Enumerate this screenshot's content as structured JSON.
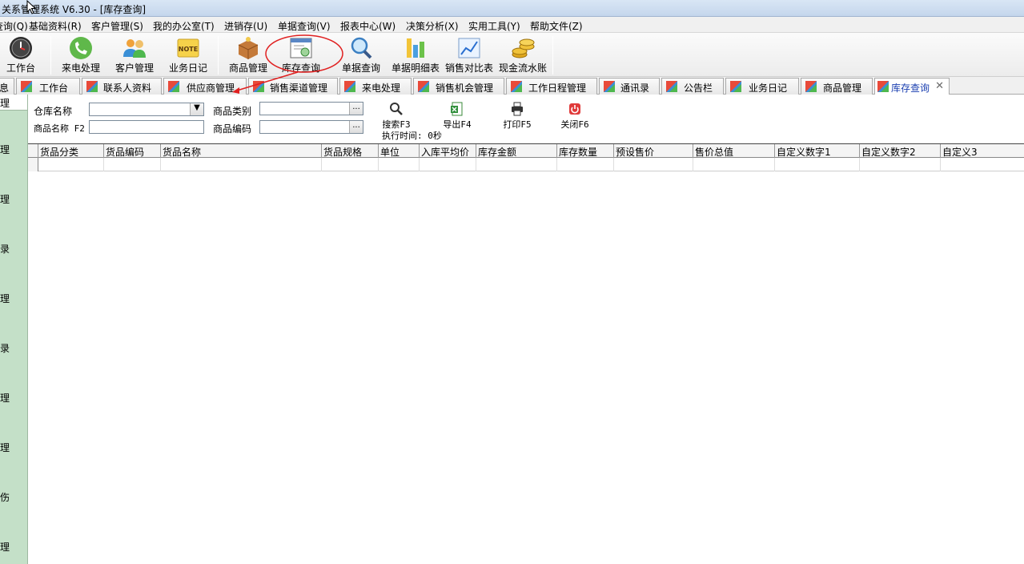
{
  "window": {
    "title": "关系管理系统 V6.30 - [库存查询]"
  },
  "menu": [
    {
      "label": "查询(Q)"
    },
    {
      "label": "基础资料(R)"
    },
    {
      "label": "客户管理(S)"
    },
    {
      "label": "我的办公室(T)"
    },
    {
      "label": "进销存(U)"
    },
    {
      "label": "单据查询(V)"
    },
    {
      "label": "报表中心(W)"
    },
    {
      "label": "决策分析(X)"
    },
    {
      "label": "实用工具(Y)"
    },
    {
      "label": "帮助文件(Z)"
    }
  ],
  "toolbar": [
    {
      "label": "工作台",
      "icon": "clock-icon"
    },
    {
      "label": "来电处理",
      "icon": "phone-icon"
    },
    {
      "label": "客户管理",
      "icon": "users-icon"
    },
    {
      "label": "业务日记",
      "icon": "note-icon",
      "icon_text": "NOTE"
    },
    {
      "label": "商品管理",
      "icon": "box-icon"
    },
    {
      "label": "库存查询",
      "icon": "window-search-icon"
    },
    {
      "label": "单据查询",
      "icon": "magnifier-icon"
    },
    {
      "label": "单据明细表",
      "icon": "bar-chart-icon"
    },
    {
      "label": "销售对比表",
      "icon": "line-chart-icon"
    },
    {
      "label": "现金流水账",
      "icon": "coins-icon"
    }
  ],
  "tabs": [
    {
      "label": "息"
    },
    {
      "label": "工作台"
    },
    {
      "label": "联系人资料"
    },
    {
      "label": "供应商管理"
    },
    {
      "label": "销售渠道管理"
    },
    {
      "label": "来电处理"
    },
    {
      "label": "销售机会管理"
    },
    {
      "label": "工作日程管理"
    },
    {
      "label": "通讯录"
    },
    {
      "label": "公告栏"
    },
    {
      "label": "业务日记"
    },
    {
      "label": "商品管理"
    },
    {
      "label": "库存查询",
      "active": true,
      "close": "✕"
    }
  ],
  "sidebar": [
    "理",
    "理",
    "理",
    "录",
    "理",
    "录",
    "理",
    "理",
    "伤",
    "理"
  ],
  "search": {
    "warehouse_label": "仓库名称",
    "warehouse_value": "",
    "product_name_label": "商品名称 F2",
    "product_name_value": "",
    "category_label": "商品类别",
    "category_value": "",
    "code_label": "商品编码",
    "code_value": "",
    "browse": "...",
    "exec_time": "执行时间: 0秒"
  },
  "actions": [
    {
      "label": "搜索F3",
      "icon": "search-icon"
    },
    {
      "label": "导出F4",
      "icon": "excel-export-icon"
    },
    {
      "label": "打印F5",
      "icon": "printer-icon"
    },
    {
      "label": "关闭F6",
      "icon": "power-close-icon"
    }
  ],
  "grid": {
    "columns": [
      "货品分类",
      "货品编码",
      "货品名称",
      "货品规格",
      "单位",
      "入库平均价",
      "库存金额",
      "库存数量",
      "预设售价",
      "售价总值",
      "自定义数字1",
      "自定义数字2",
      "自定义3"
    ],
    "rows": []
  },
  "colors": {
    "accent_tab_text": "#1a3fb0",
    "sidebar_bg": "#c4e0c8",
    "annotation": "#e02020"
  }
}
